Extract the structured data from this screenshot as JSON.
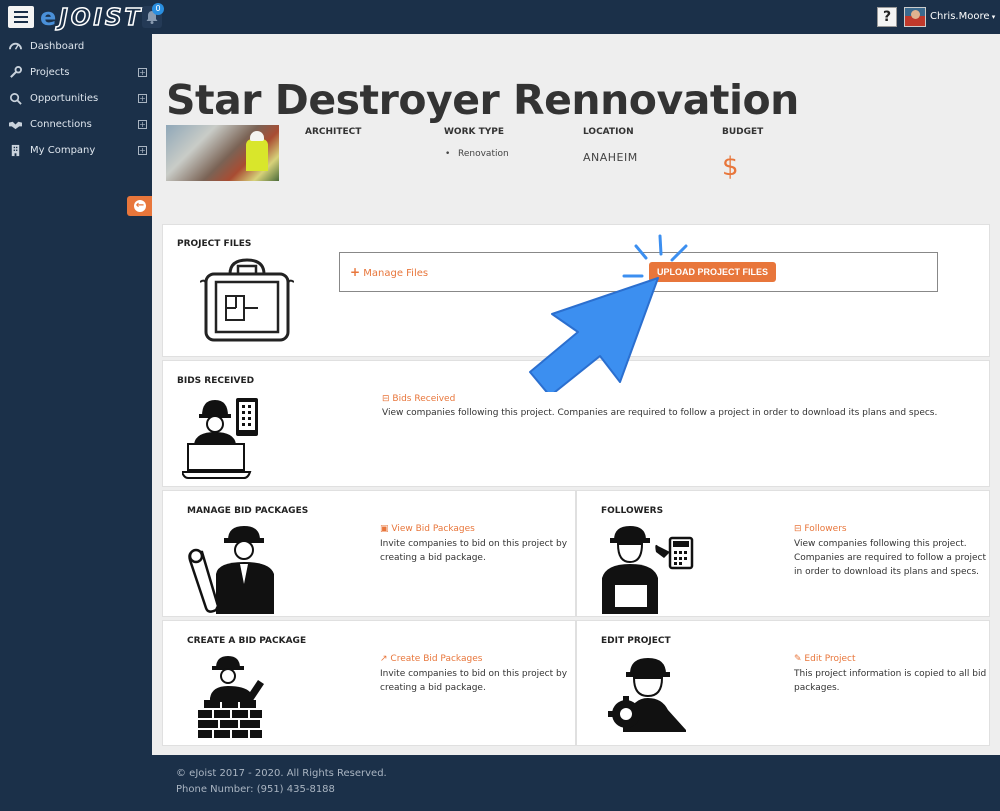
{
  "header": {
    "logo": "eJOIST",
    "notification_count": "0",
    "help_label": "?",
    "username": "Chris.Moore"
  },
  "sidebar": {
    "items": [
      {
        "label": "Dashboard",
        "icon": "dashboard-icon"
      },
      {
        "label": "Projects",
        "icon": "wrench-icon",
        "expand": "+"
      },
      {
        "label": "Opportunities",
        "icon": "search-icon",
        "expand": "+"
      },
      {
        "label": "Connections",
        "icon": "handshake-icon",
        "expand": "+"
      },
      {
        "label": "My Company",
        "icon": "building-icon",
        "expand": "+"
      }
    ]
  },
  "project": {
    "title": "Star Destroyer Rennovation",
    "architect_label": "ARCHITECT",
    "work_type_label": "WORK TYPE",
    "work_type_value": "Renovation",
    "location_label": "LOCATION",
    "location_value": "ANAHEIM",
    "budget_label": "BUDGET",
    "budget_value": "$"
  },
  "project_files": {
    "title": "PROJECT FILES",
    "manage_label": "Manage Files",
    "upload_label": "UPLOAD PROJECT FILES"
  },
  "bids_received": {
    "title": "BIDS RECEIVED",
    "link": "Bids Received",
    "desc": "View companies following this project. Companies are required to follow a project in order to download its plans and specs."
  },
  "manage_bid_packages": {
    "title": "MANAGE BID PACKAGES",
    "link": "View Bid Packages",
    "desc_1": "Invite companies to bid on this project by",
    "desc_2": "creating a bid package."
  },
  "followers": {
    "title": "FOLLOWERS",
    "link": "Followers",
    "desc_1": "View companies following this project.",
    "desc_2": "Companies are required to follow a project",
    "desc_3": "in order to download its plans and specs."
  },
  "create_bid_package": {
    "title": "CREATE A BID PACKAGE",
    "link": "Create Bid Packages",
    "desc_1": "Invite companies to bid on this project by",
    "desc_2": "creating a bid package."
  },
  "edit_project": {
    "title": "EDIT PROJECT",
    "link": "Edit Project",
    "desc_1": "This project information is copied to all bid",
    "desc_2": "packages."
  },
  "footer": {
    "copyright": "© eJoist 2017 - 2020. All Rights Reserved.",
    "phone": "Phone Number: (951) 435-8188"
  },
  "colors": {
    "navy": "#1b3049",
    "accent": "#e8763b",
    "pointer": "#3c8ff0"
  }
}
